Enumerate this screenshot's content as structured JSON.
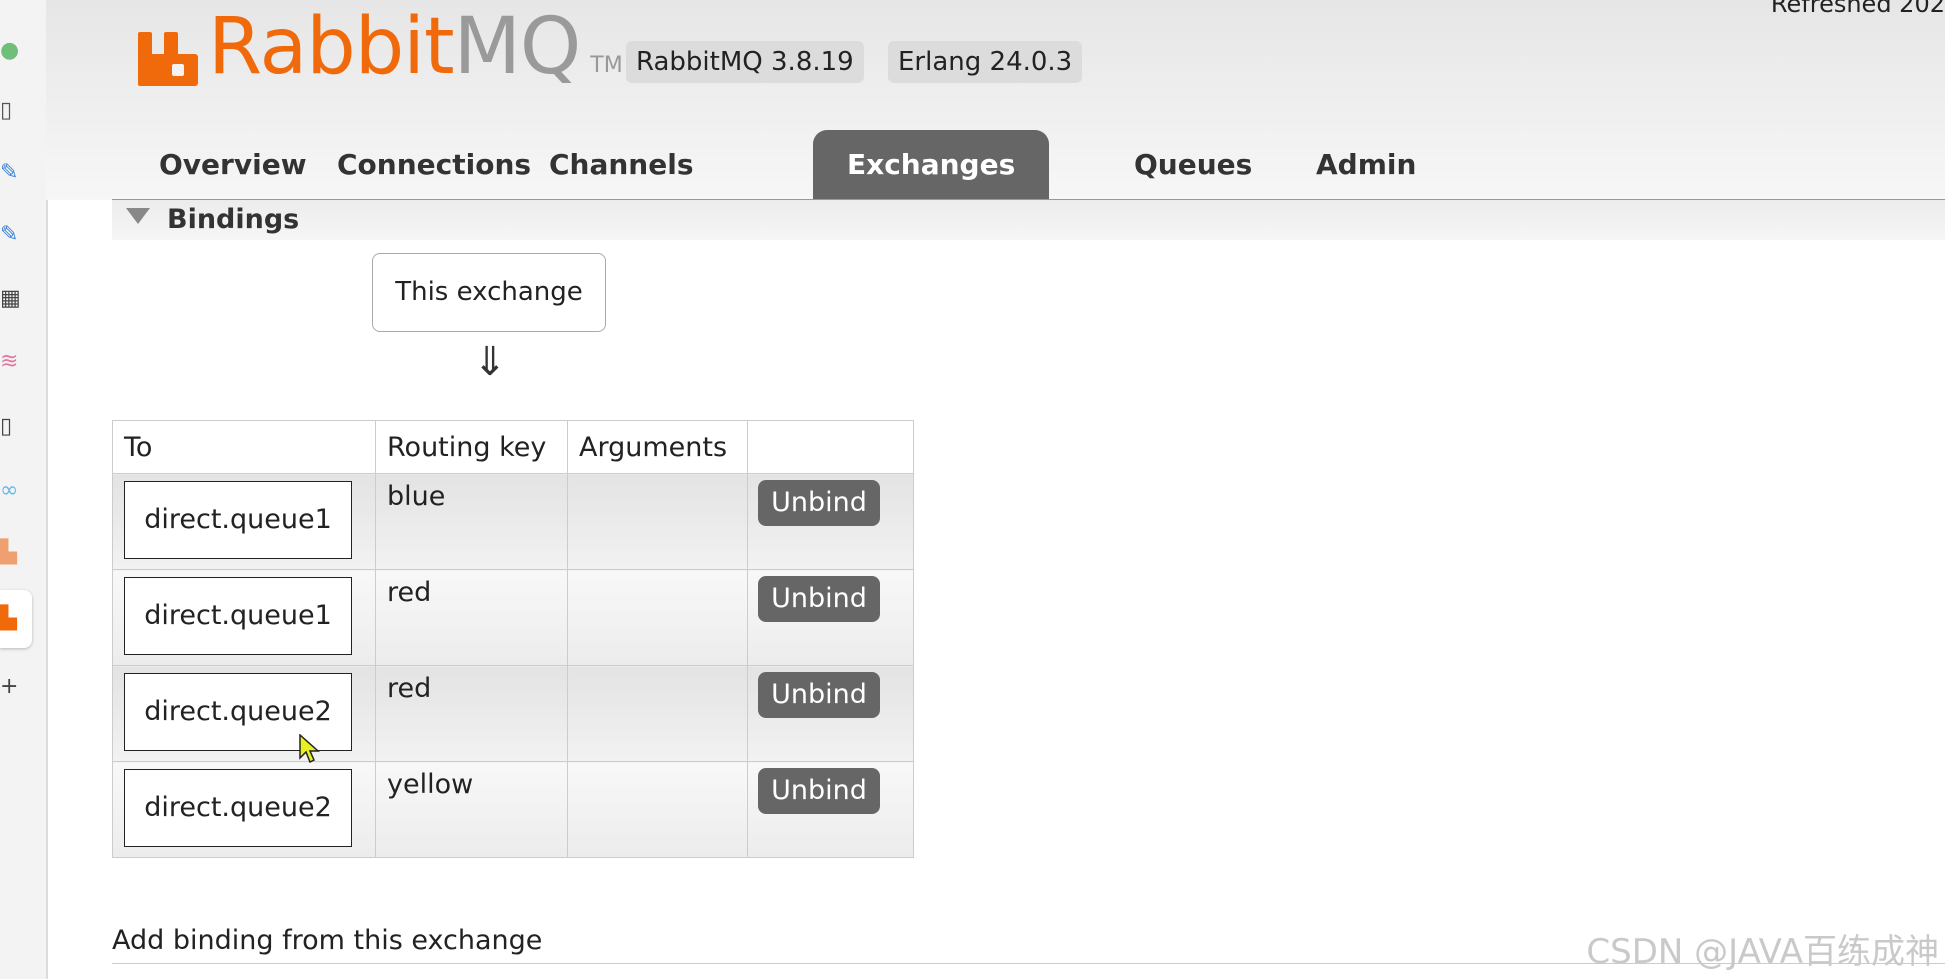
{
  "header": {
    "logo_rabbit": "Rabbit",
    "logo_mq": "MQ",
    "logo_tm": "TM",
    "version": "RabbitMQ 3.8.19",
    "erlang": "Erlang 24.0.3",
    "refreshed": "Refreshed 202"
  },
  "tabs": [
    {
      "label": "Overview"
    },
    {
      "label": "Connections"
    },
    {
      "label": "Channels"
    },
    {
      "label": "Exchanges",
      "active": true
    },
    {
      "label": "Queues"
    },
    {
      "label": "Admin"
    }
  ],
  "bindings": {
    "title": "Bindings",
    "this_exchange": "This exchange",
    "arrow": "⇓",
    "columns": [
      "To",
      "Routing key",
      "Arguments",
      ""
    ],
    "rows": [
      {
        "to": "direct.queue1",
        "routing_key": "blue",
        "arguments": "",
        "action": "Unbind"
      },
      {
        "to": "direct.queue1",
        "routing_key": "red",
        "arguments": "",
        "action": "Unbind"
      },
      {
        "to": "direct.queue2",
        "routing_key": "red",
        "arguments": "",
        "action": "Unbind"
      },
      {
        "to": "direct.queue2",
        "routing_key": "yellow",
        "arguments": "",
        "action": "Unbind"
      }
    ]
  },
  "add_binding": "Add binding from this exchange",
  "watermark": "CSDN @JAVA百练成神",
  "colors": {
    "brand": "#f06a0b",
    "tab_active": "#666666",
    "button": "#666666"
  }
}
